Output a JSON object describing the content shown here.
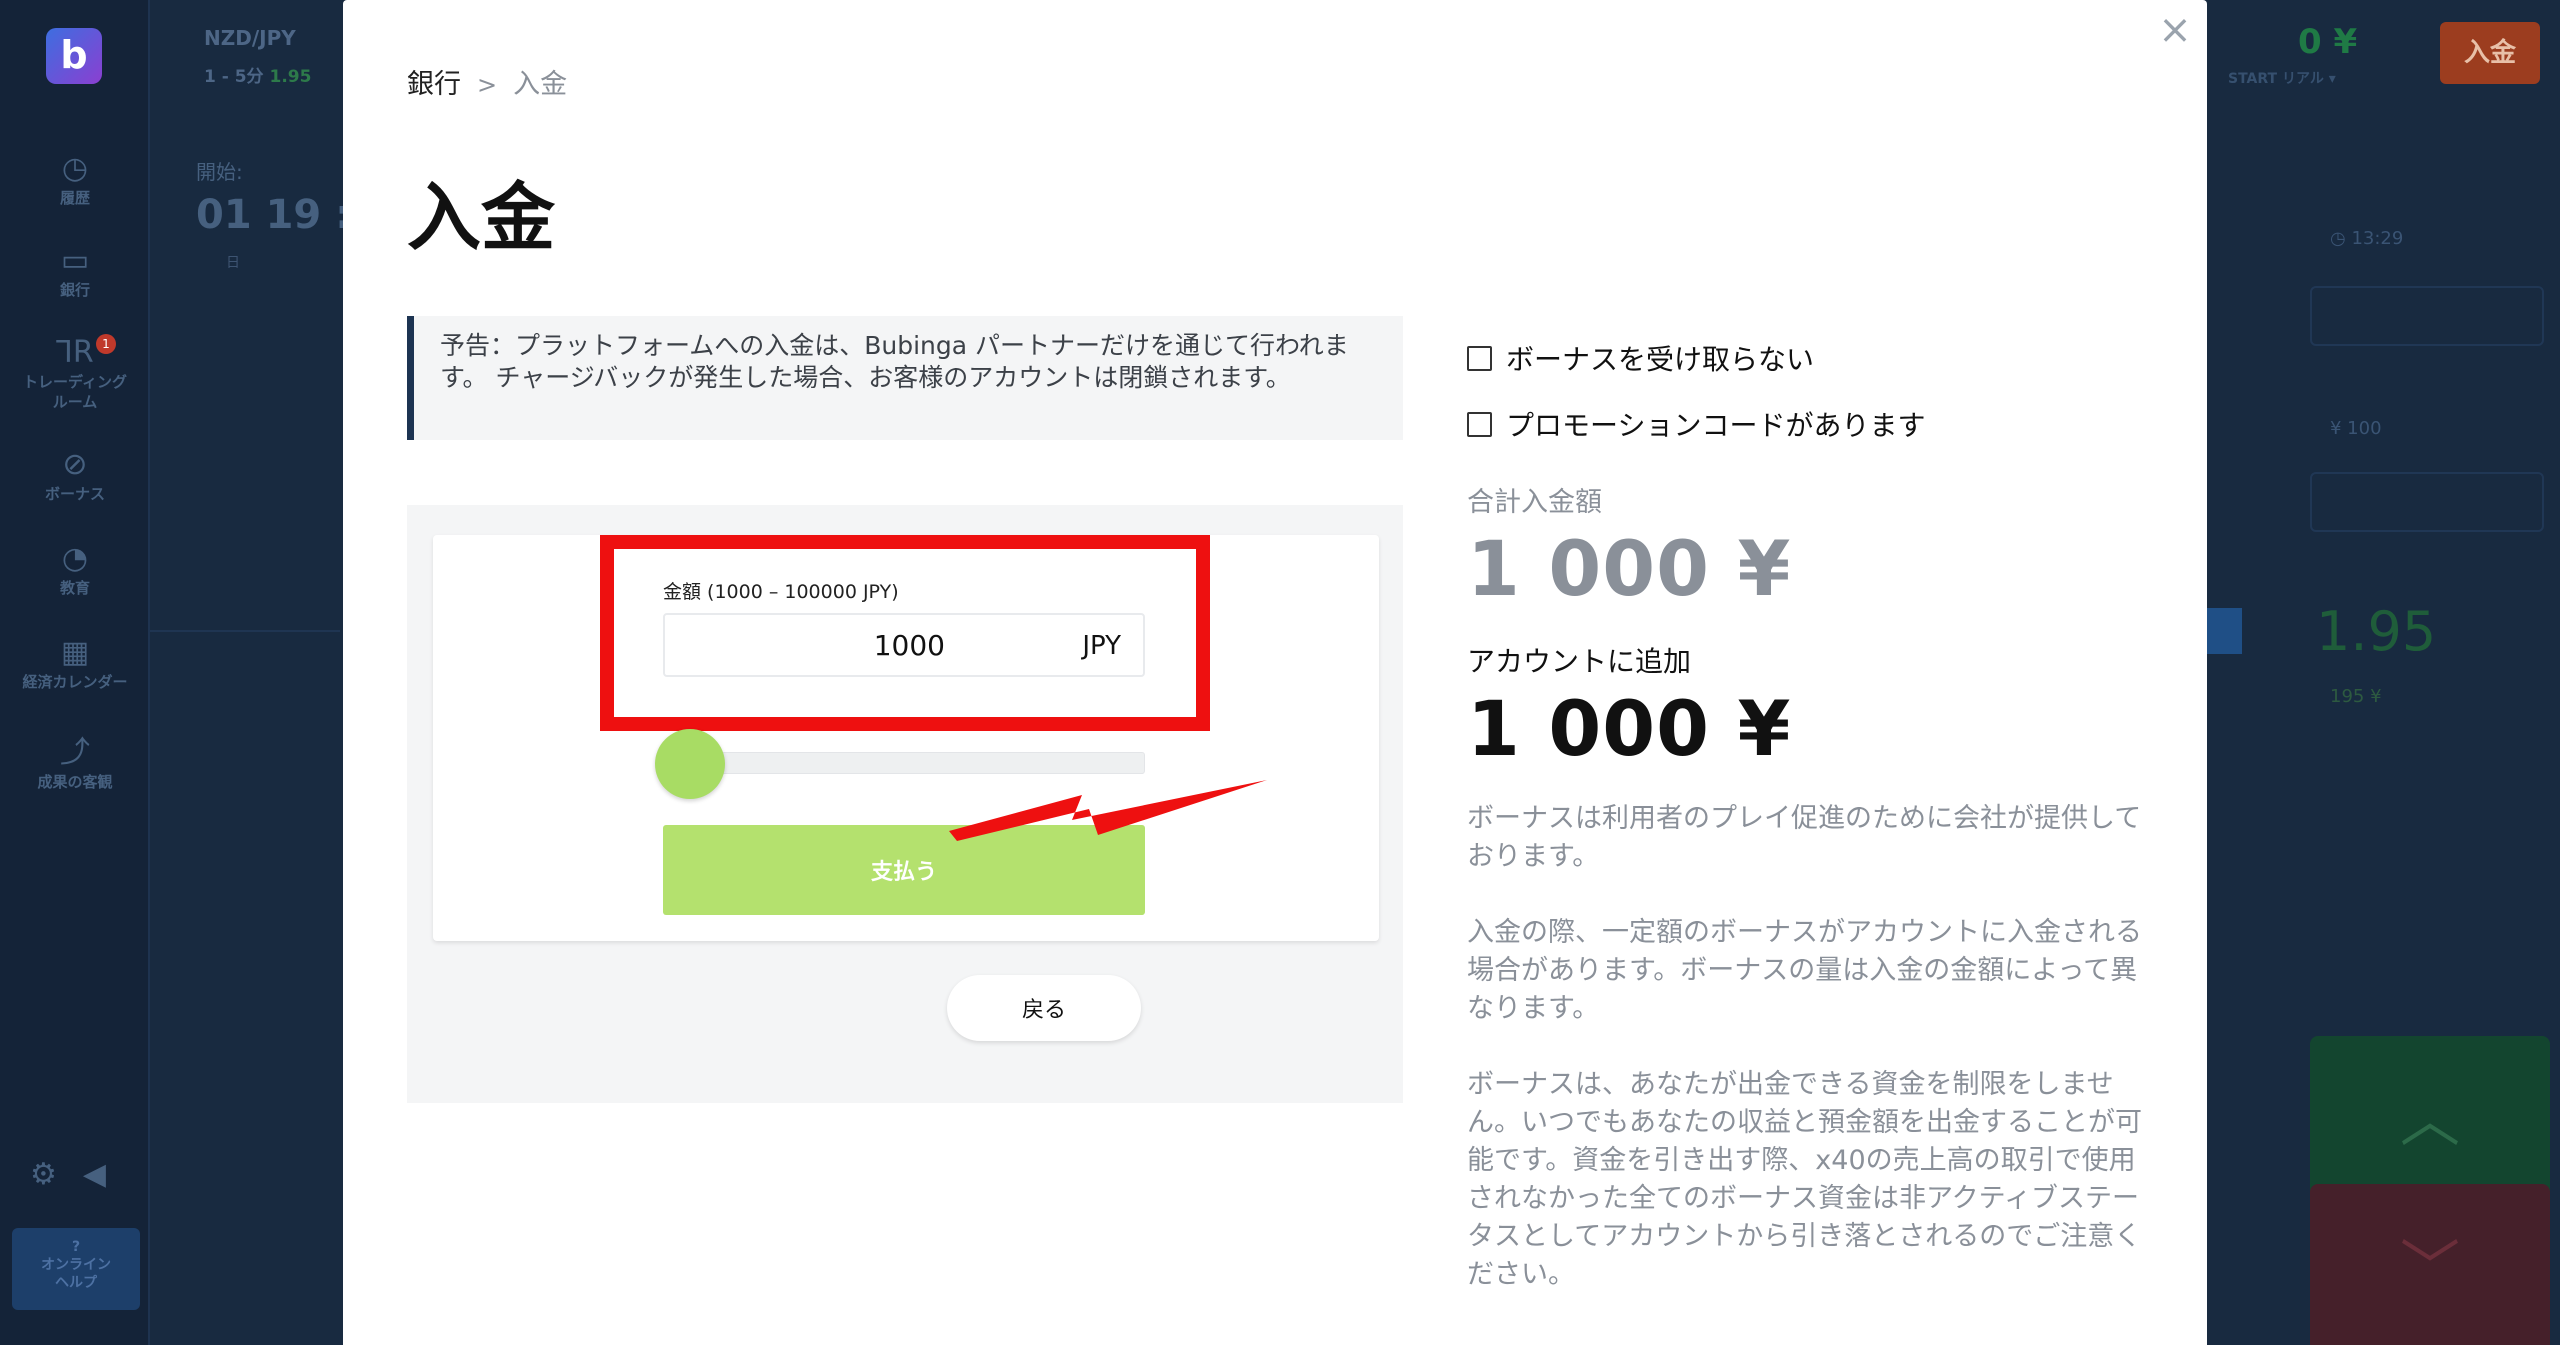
{
  "background": {
    "logo_letter": "b",
    "pair_name": "NZD/JPY",
    "pair_sub": "1 - 5分",
    "pair_payout": "1.95",
    "start_label": "開始:",
    "start_value": "01  19 :",
    "start_units": "日 時",
    "sidebar": [
      {
        "icon": "◷",
        "label": "履歴"
      },
      {
        "icon": "▭",
        "label": "銀行"
      },
      {
        "icon": "⅂R",
        "label": "トレーディング\nルーム"
      },
      {
        "icon": "⊘",
        "label": "ボーナス"
      },
      {
        "icon": "◔",
        "label": "教育"
      },
      {
        "icon": "▦",
        "label": "経済カレンダー"
      },
      {
        "icon": "⤴",
        "label": "成果の客観"
      }
    ],
    "sidebar_badge": "1",
    "help_label": "オンライン\nヘルプ",
    "balance": "0 ¥",
    "balance_sub": "START  リアル ▾",
    "deposit_button": "入金",
    "right_panel": {
      "time": "13:29",
      "amount": "¥ 100",
      "payout": "1.95",
      "payout_sub": "195 ¥"
    }
  },
  "modal": {
    "close_label": "×",
    "breadcrumb": {
      "root": "銀行",
      "separator": ">",
      "current": "入金"
    },
    "title": "入金",
    "notice": "予告：プラットフォームへの入金は、Bubinga パートナーだけを通じて行われます。 チャージバックが発生した場合、お客様のアカウントは閉鎖されます。",
    "amount_label": "金額 (1000 – 100000 JPY)",
    "amount_value": "1000",
    "amount_unit": "JPY",
    "slider_fraction": 0.0,
    "pay_button": "支払う",
    "back_button": "戻る",
    "checkbox_no_bonus": "ボーナスを受け取らない",
    "checkbox_promo": "プロモーションコードがあります",
    "total_label": "合計入金額",
    "total_value": "1 000 ¥",
    "add_label": "アカウントに追加",
    "add_value": "1 000 ¥",
    "info_1": "ボーナスは利用者のプレイ促進のために会社が提供しております。",
    "info_2": "入金の際、一定額のボーナスがアカウントに入金される場合があります。ボーナスの量は入金の金額によって異なります。",
    "info_3": "ボーナスは、あなたが出金できる資金を制限をしません。いつでもあなたの収益と預金額を出金することが可能です。資金を引き出す際、x40の売上高の取引で使用されなかった全てのボーナス資金は非アクティブステータスとしてアカウントから引き落とされるのでご注意ください。"
  },
  "colors": {
    "highlight": "#ee1010",
    "pay_button": "#b4e16e",
    "slider_thumb": "#a8dc64",
    "notice_border": "#1d3452"
  }
}
